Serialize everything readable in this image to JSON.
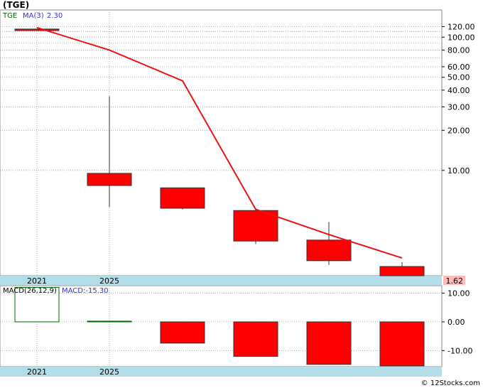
{
  "title": "(TGE)",
  "watermark": "© 12Stocks.com",
  "colors": {
    "candle_down": "#ff0000",
    "candle_up": "#ffffff",
    "up_border": "#006600",
    "ma_line": "#ee1111",
    "legend_green": "#006600",
    "legend_blue": "#3333cc",
    "axis_band": "#b3dde8",
    "last_price_bg": "#ffbbbb",
    "grid": "#aaaaaa"
  },
  "chart_data": [
    {
      "type": "candlestick",
      "name": "price",
      "legend": {
        "ticker": "TGE",
        "ma_label": "MA(3)",
        "ma_value": "2.30"
      },
      "scale": "log",
      "ylim": [
        1.62,
        160
      ],
      "yticks": [
        10,
        20,
        30,
        40,
        50,
        60,
        80,
        100,
        120
      ],
      "ytick_labels": [
        "10.00",
        "20.00",
        "30.00",
        "40.00",
        "50.00",
        "60.00",
        "80.00",
        "100.00",
        "120.00"
      ],
      "xtick_labels": [
        "2021",
        "2025"
      ],
      "last_price": "1.62",
      "candles": [
        {
          "open": 115,
          "high": 115,
          "low": 112,
          "close": 112
        },
        {
          "open": 9.5,
          "high": 36,
          "low": 5.3,
          "close": 7.7
        },
        {
          "open": 7.4,
          "high": 7.4,
          "low": 5.1,
          "close": 5.2
        },
        {
          "open": 5.0,
          "high": 5.2,
          "low": 2.8,
          "close": 2.95
        },
        {
          "open": 3.0,
          "high": 4.1,
          "low": 1.95,
          "close": 2.1
        },
        {
          "open": 1.9,
          "high": 2.05,
          "low": 1.62,
          "close": 1.62
        }
      ],
      "ma": [
        118,
        80,
        47,
        5.1,
        3.3,
        2.2
      ]
    },
    {
      "type": "bar",
      "name": "macd",
      "legend": {
        "label": "MACD(26,12,9)",
        "value_label": "MACD:-15.30"
      },
      "ylim": [
        -15.6,
        12.6
      ],
      "yticks": [
        10,
        0,
        -10
      ],
      "ytick_labels": [
        "10.00",
        "0.00",
        "-10.00"
      ],
      "xtick_labels": [
        "2021",
        "2025"
      ],
      "values": [
        12,
        0.25,
        -7.4,
        -12,
        -14.8,
        -15.3
      ]
    }
  ]
}
